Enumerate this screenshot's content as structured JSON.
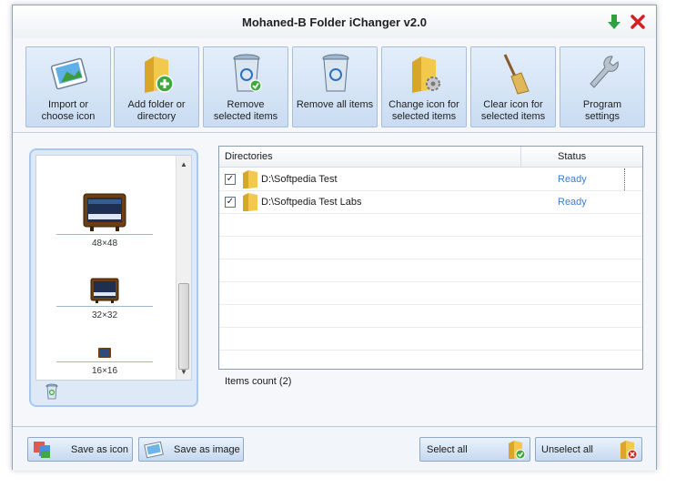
{
  "window": {
    "title": "Mohaned-B Folder iChanger v2.0"
  },
  "toolbar": {
    "buttons": [
      {
        "id": "import",
        "line1": "Import or",
        "line2": "choose icon"
      },
      {
        "id": "add",
        "line1": "Add folder or",
        "line2": "directory"
      },
      {
        "id": "remove_sel",
        "line1": "Remove",
        "line2": "selected items"
      },
      {
        "id": "remove_all",
        "line1": "Remove all items",
        "line2": ""
      },
      {
        "id": "change",
        "line1": "Change icon for",
        "line2": "selected items"
      },
      {
        "id": "clear",
        "line1": "Clear icon for",
        "line2": "selected items"
      },
      {
        "id": "settings",
        "line1": "Program",
        "line2": "settings"
      }
    ]
  },
  "icon_sizes": [
    {
      "label": "48×48"
    },
    {
      "label": "32×32"
    },
    {
      "label": "16×16"
    }
  ],
  "grid": {
    "columns": {
      "directories": "Directories",
      "status": "Status"
    },
    "rows": [
      {
        "checked": true,
        "path": "D:\\Softpedia Test",
        "status": "Ready"
      },
      {
        "checked": true,
        "path": "D:\\Softpedia Test Labs",
        "status": "Ready"
      }
    ]
  },
  "items_count": "Items count (2)",
  "bottom": {
    "save_icon": "Save as icon",
    "save_image": "Save as image",
    "select_all": "Select all",
    "unselect_all": "Unselect all"
  },
  "colors": {
    "status_ready": "#3b7ed4",
    "toolbar_button": "#c9dcf2",
    "close_red": "#d42020",
    "minimize_green": "#2ea043"
  }
}
